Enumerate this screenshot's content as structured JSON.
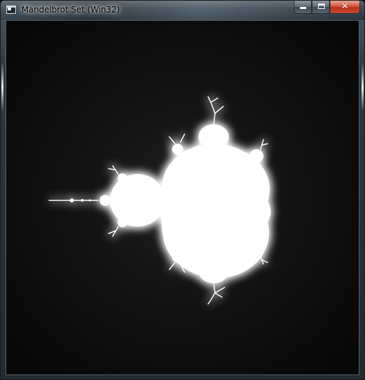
{
  "window": {
    "title": "Mandelbrot Set (Win32)",
    "icon": "application-icon",
    "controls": {
      "minimize_icon": "minimize-icon",
      "maximize_icon": "maximize-icon",
      "close_icon": "close-icon",
      "close_glyph": "✕"
    }
  },
  "canvas": {
    "content": "mandelbrot-fractal",
    "background_color": "#000000",
    "set_color": "#ffffff"
  }
}
